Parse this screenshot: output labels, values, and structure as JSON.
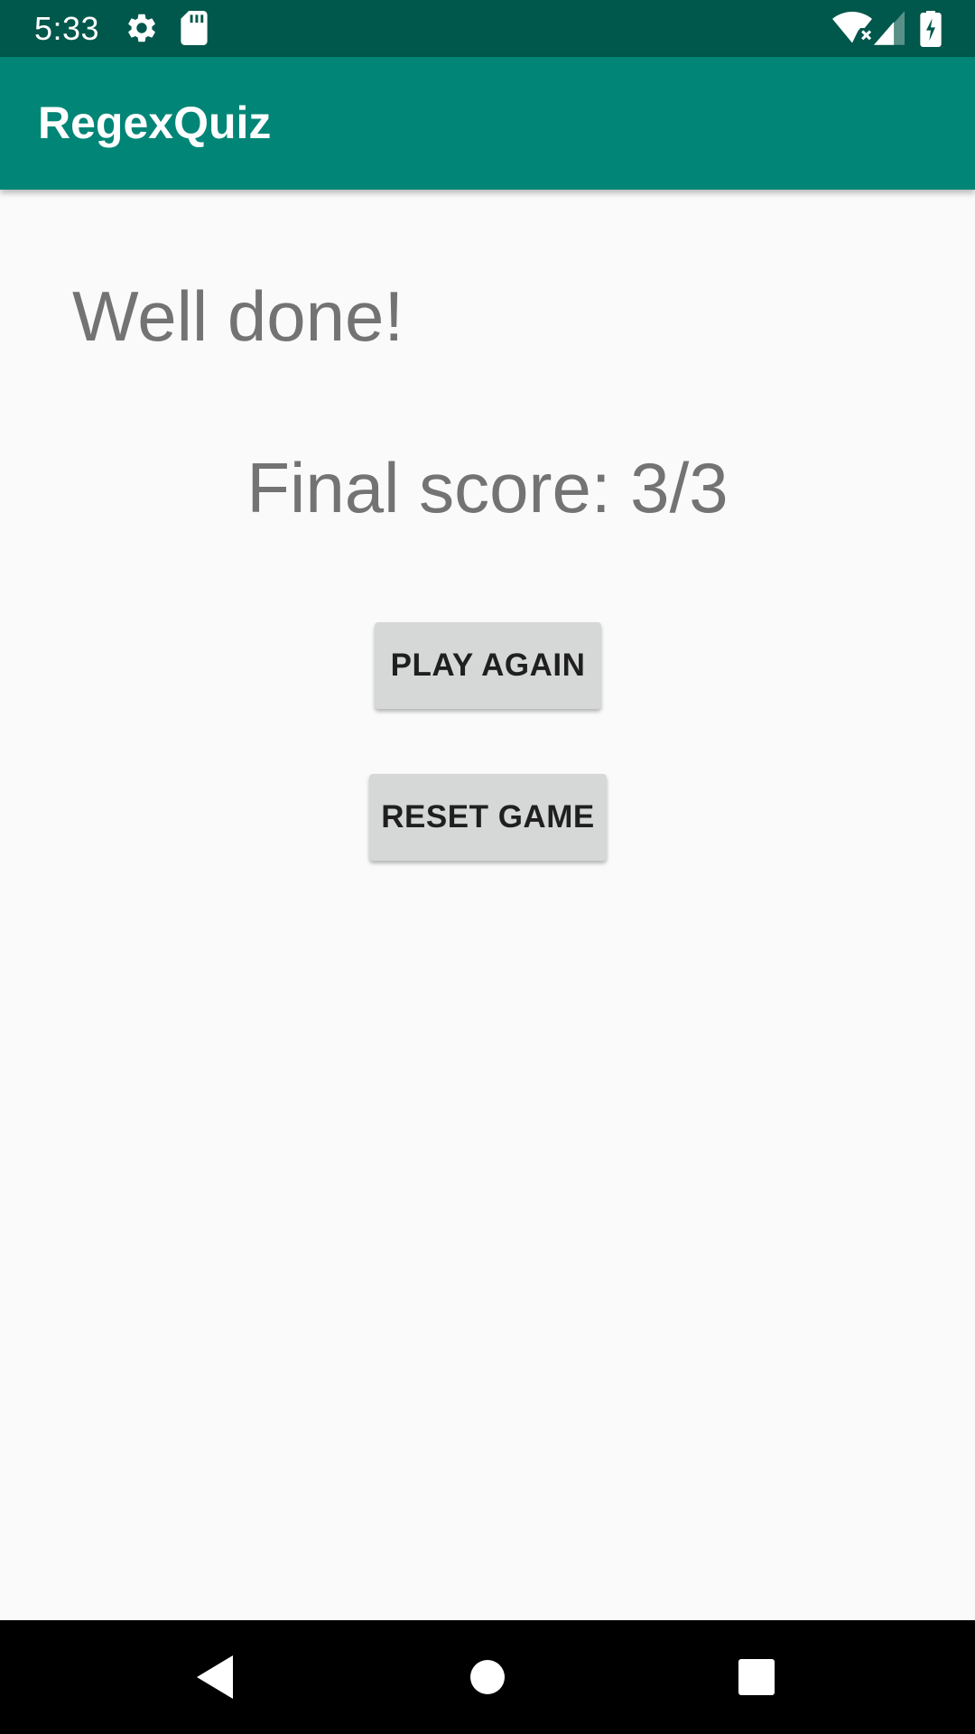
{
  "status_bar": {
    "time": "5:33",
    "icons": [
      "gear-icon",
      "sd-card-icon",
      "wifi-icon",
      "signal-icon",
      "battery-charging-icon"
    ],
    "background": "#00574b"
  },
  "app_bar": {
    "title": "RegexQuiz",
    "background": "#008577"
  },
  "main": {
    "heading": "Well done!",
    "score_text": "Final score: 3/3",
    "play_again_label": "PLAY AGAIN",
    "reset_game_label": "RESET GAME"
  },
  "nav_bar": {
    "buttons": [
      "back-icon",
      "home-icon",
      "recents-icon"
    ]
  }
}
